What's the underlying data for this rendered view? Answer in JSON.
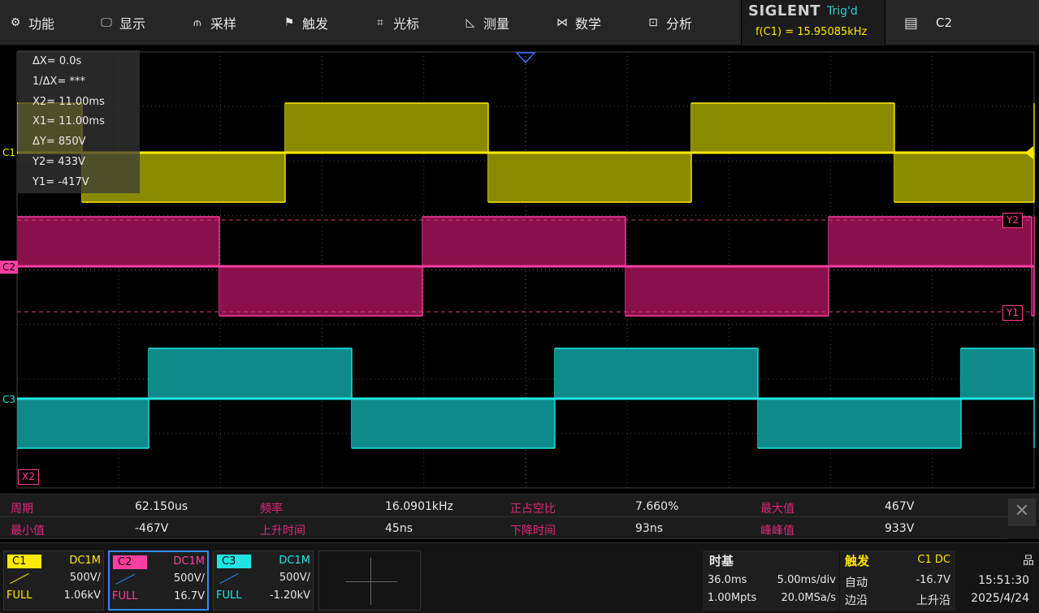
{
  "menu": [
    {
      "icon": "⚙",
      "label": "功能",
      "name": "menu-function",
      "icon_name": "gear-icon"
    },
    {
      "icon": "🖵",
      "label": "显示",
      "name": "menu-display",
      "icon_name": "monitor-icon"
    },
    {
      "icon": "⫙",
      "label": "采样",
      "name": "menu-acquire",
      "icon_name": "sample-icon"
    },
    {
      "icon": "⚑",
      "label": "触发",
      "name": "menu-trigger",
      "icon_name": "flag-icon"
    },
    {
      "icon": "⌗",
      "label": "光标",
      "name": "menu-cursor",
      "icon_name": "cursor-grid-icon"
    },
    {
      "icon": "◺",
      "label": "测量",
      "name": "menu-measure",
      "icon_name": "ruler-icon"
    },
    {
      "icon": "⋈",
      "label": "数学",
      "name": "menu-math",
      "icon_name": "math-icon"
    },
    {
      "icon": "⊡",
      "label": "分析",
      "name": "menu-analysis",
      "icon_name": "analysis-icon"
    }
  ],
  "brand": "SIGLENT",
  "trigger_state": "Trig'd",
  "trigger_freq": "f(C1) = 15.95085kHz",
  "top_channel": "C2",
  "cursor_info": [
    "ΔX= 0.0s",
    "1/ΔX= ***",
    "X2= 11.00ms",
    "X1= 11.00ms",
    "ΔY= 850V",
    "Y2= 433V",
    "Y1= -417V"
  ],
  "tags": {
    "c1": "C1",
    "c2": "C2",
    "c3": "C3",
    "y1": "Y1",
    "y2": "Y2",
    "x2": "X2"
  },
  "measurements": {
    "row1": [
      {
        "label": "周期",
        "value": "62.150us"
      },
      {
        "label": "频率",
        "value": "16.0901kHz"
      },
      {
        "label": "正占空比",
        "value": "7.660%"
      },
      {
        "label": "最大值",
        "value": "467V"
      }
    ],
    "row2": [
      {
        "label": "最小值",
        "value": "-467V"
      },
      {
        "label": "上升时间",
        "value": "45ns"
      },
      {
        "label": "下降时间",
        "value": "93ns"
      },
      {
        "label": "峰峰值",
        "value": "933V"
      }
    ]
  },
  "channels": [
    {
      "name": "C1",
      "coupling": "DC1M",
      "scale": "500V/",
      "bw": "FULL",
      "offset": "1.06kV",
      "color": "#ffea00"
    },
    {
      "name": "C2",
      "coupling": "DC1M",
      "scale": "500V/",
      "bw": "FULL",
      "offset": "16.7V",
      "color": "#ff3fa0"
    },
    {
      "name": "C3",
      "coupling": "DC1M",
      "scale": "500V/",
      "bw": "FULL",
      "offset": "-1.20kV",
      "color": "#22e4e4"
    }
  ],
  "timebase": {
    "title": "时基",
    "delay": "36.0ms",
    "scale": "5.00ms/div",
    "memory": "1.00Mpts",
    "sample_rate": "20.0MSa/s"
  },
  "trigger": {
    "title": "触发",
    "source": "C1 DC",
    "mode": "自动",
    "level": "-16.7V",
    "type": "边沿",
    "slope": "上升沿"
  },
  "clock": {
    "time": "15:51:30",
    "date": "2025/4/24"
  },
  "colors": {
    "c1": "#ffea00",
    "c2": "#ff3fa0",
    "c3": "#22e4e4",
    "c1_fill": "#8a8a00",
    "c2_fill": "#8a0f4a",
    "c3_fill": "#0f8a8a"
  }
}
